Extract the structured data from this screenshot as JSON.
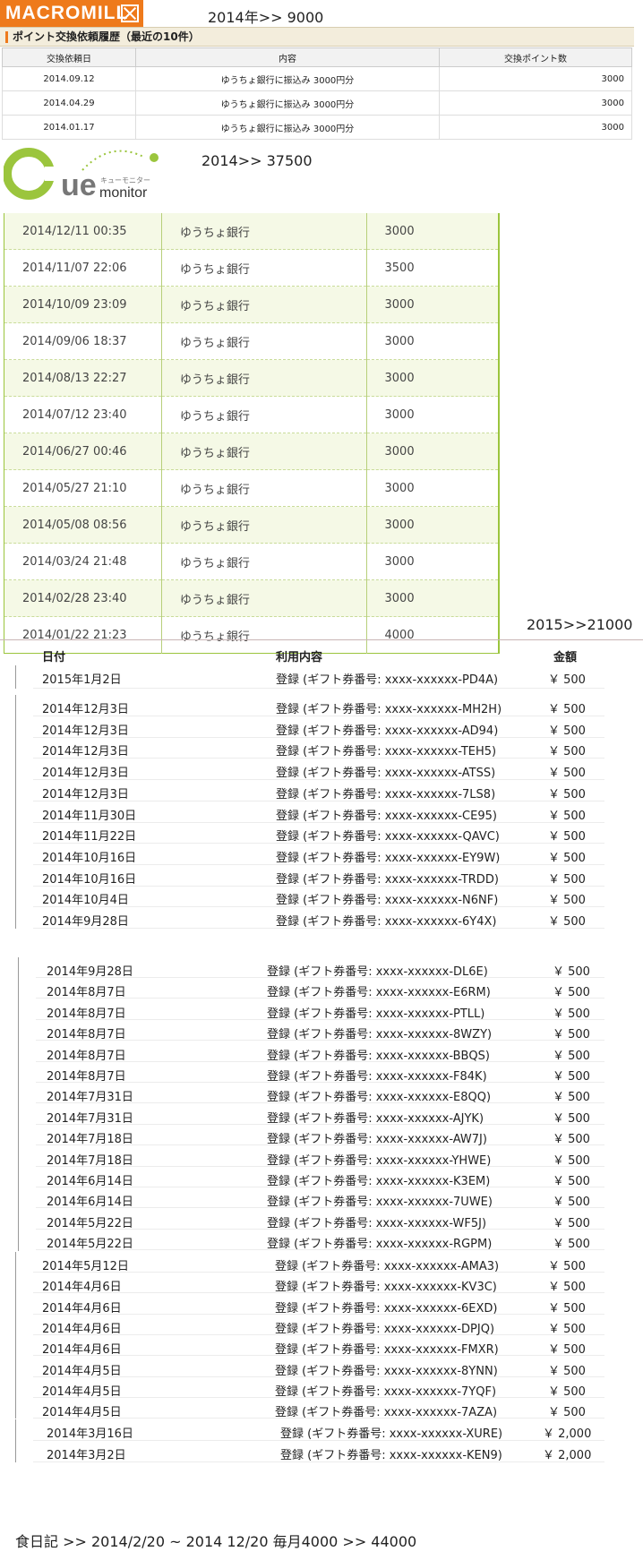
{
  "macromill": {
    "logo_text": "MACROMILL",
    "total": "2014年>> 9000",
    "header": "ポイント交換依頼履歴（最近の10件）",
    "columns": [
      "交換依頼日",
      "内容",
      "交換ポイント数"
    ],
    "rows": [
      {
        "date": "2014.09.12",
        "content": "ゆうちょ銀行に振込み 3000円分",
        "points": "3000"
      },
      {
        "date": "2014.04.29",
        "content": "ゆうちょ銀行に振込み 3000円分",
        "points": "3000"
      },
      {
        "date": "2014.01.17",
        "content": "ゆうちょ銀行に振込み 3000円分",
        "points": "3000"
      }
    ]
  },
  "cue": {
    "logo_main": "Cue",
    "logo_sub": "monitor",
    "logo_kana": "キューモニター",
    "total": "2014>> 37500",
    "rows": [
      {
        "date": "2014/12/11 00:35",
        "bank": "ゆうちょ銀行",
        "amount": "3000"
      },
      {
        "date": "2014/11/07 22:06",
        "bank": "ゆうちょ銀行",
        "amount": "3500"
      },
      {
        "date": "2014/10/09 23:09",
        "bank": "ゆうちょ銀行",
        "amount": "3000"
      },
      {
        "date": "2014/09/06 18:37",
        "bank": "ゆうちょ銀行",
        "amount": "3000"
      },
      {
        "date": "2014/08/13 22:27",
        "bank": "ゆうちょ銀行",
        "amount": "3000"
      },
      {
        "date": "2014/07/12 23:40",
        "bank": "ゆうちょ銀行",
        "amount": "3000"
      },
      {
        "date": "2014/06/27 00:46",
        "bank": "ゆうちょ銀行",
        "amount": "3000"
      },
      {
        "date": "2014/05/27 21:10",
        "bank": "ゆうちょ銀行",
        "amount": "3000"
      },
      {
        "date": "2014/05/08 08:56",
        "bank": "ゆうちょ銀行",
        "amount": "3000"
      },
      {
        "date": "2014/03/24 21:48",
        "bank": "ゆうちょ銀行",
        "amount": "3000"
      },
      {
        "date": "2014/02/28 23:40",
        "bank": "ゆうちょ銀行",
        "amount": "3000"
      },
      {
        "date": "2014/01/22 21:23",
        "bank": "ゆうちょ銀行",
        "amount": "4000"
      }
    ]
  },
  "gift": {
    "total": "2015>>21000",
    "columns": [
      "日付",
      "利用内容",
      "金額"
    ],
    "rows": [
      {
        "date": "2015年1月2日",
        "desc": "登録 (ギフト券番号: xxxx-xxxxxx-PD4A)",
        "amount": "￥ 500"
      },
      {
        "date": "2014年12月3日",
        "desc": "登録 (ギフト券番号: xxxx-xxxxxx-MH2H)",
        "amount": "￥ 500"
      },
      {
        "date": "2014年12月3日",
        "desc": "登録 (ギフト券番号: xxxx-xxxxxx-AD94)",
        "amount": "￥ 500"
      },
      {
        "date": "2014年12月3日",
        "desc": "登録 (ギフト券番号: xxxx-xxxxxx-TEH5)",
        "amount": "￥ 500"
      },
      {
        "date": "2014年12月3日",
        "desc": "登録 (ギフト券番号: xxxx-xxxxxx-ATSS)",
        "amount": "￥ 500"
      },
      {
        "date": "2014年12月3日",
        "desc": "登録 (ギフト券番号: xxxx-xxxxxx-7LS8)",
        "amount": "￥ 500"
      },
      {
        "date": "2014年11月30日",
        "desc": "登録 (ギフト券番号: xxxx-xxxxxx-CE95)",
        "amount": "￥ 500"
      },
      {
        "date": "2014年11月22日",
        "desc": "登録 (ギフト券番号: xxxx-xxxxxx-QAVC)",
        "amount": "￥ 500"
      },
      {
        "date": "2014年10月16日",
        "desc": "登録 (ギフト券番号: xxxx-xxxxxx-EY9W)",
        "amount": "￥ 500"
      },
      {
        "date": "2014年10月16日",
        "desc": "登録 (ギフト券番号: xxxx-xxxxxx-TRDD)",
        "amount": "￥ 500"
      },
      {
        "date": "2014年10月4日",
        "desc": "登録 (ギフト券番号: xxxx-xxxxxx-N6NF)",
        "amount": "￥ 500"
      },
      {
        "date": "2014年9月28日",
        "desc": "登録 (ギフト券番号: xxxx-xxxxxx-6Y4X)",
        "amount": "￥ 500"
      },
      {
        "date": "2014年9月28日",
        "desc": "登録 (ギフト券番号: xxxx-xxxxxx-DL6E)",
        "amount": "￥ 500"
      },
      {
        "date": "2014年8月7日",
        "desc": "登録 (ギフト券番号: xxxx-xxxxxx-E6RM)",
        "amount": "￥ 500"
      },
      {
        "date": "2014年8月7日",
        "desc": "登録 (ギフト券番号: xxxx-xxxxxx-PTLL)",
        "amount": "￥ 500"
      },
      {
        "date": "2014年8月7日",
        "desc": "登録 (ギフト券番号: xxxx-xxxxxx-8WZY)",
        "amount": "￥ 500"
      },
      {
        "date": "2014年8月7日",
        "desc": "登録 (ギフト券番号: xxxx-xxxxxx-BBQS)",
        "amount": "￥ 500"
      },
      {
        "date": "2014年8月7日",
        "desc": "登録 (ギフト券番号: xxxx-xxxxxx-F84K)",
        "amount": "￥ 500"
      },
      {
        "date": "2014年7月31日",
        "desc": "登録 (ギフト券番号: xxxx-xxxxxx-E8QQ)",
        "amount": "￥ 500"
      },
      {
        "date": "2014年7月31日",
        "desc": "登録 (ギフト券番号: xxxx-xxxxxx-AJYK)",
        "amount": "￥ 500"
      },
      {
        "date": "2014年7月18日",
        "desc": "登録 (ギフト券番号: xxxx-xxxxxx-AW7J)",
        "amount": "￥ 500"
      },
      {
        "date": "2014年7月18日",
        "desc": "登録 (ギフト券番号: xxxx-xxxxxx-YHWE)",
        "amount": "￥ 500"
      },
      {
        "date": "2014年6月14日",
        "desc": "登録 (ギフト券番号: xxxx-xxxxxx-K3EM)",
        "amount": "￥ 500"
      },
      {
        "date": "2014年6月14日",
        "desc": "登録 (ギフト券番号: xxxx-xxxxxx-7UWE)",
        "amount": "￥ 500"
      },
      {
        "date": "2014年5月22日",
        "desc": "登録 (ギフト券番号: xxxx-xxxxxx-WF5J)",
        "amount": "￥ 500"
      },
      {
        "date": "2014年5月22日",
        "desc": "登録 (ギフト券番号: xxxx-xxxxxx-RGPM)",
        "amount": "￥ 500"
      },
      {
        "date": "2014年5月12日",
        "desc": "登録 (ギフト券番号: xxxx-xxxxxx-AMA3)",
        "amount": "￥ 500"
      },
      {
        "date": "2014年4月6日",
        "desc": "登録 (ギフト券番号: xxxx-xxxxxx-KV3C)",
        "amount": "￥ 500"
      },
      {
        "date": "2014年4月6日",
        "desc": "登録 (ギフト券番号: xxxx-xxxxxx-6EXD)",
        "amount": "￥ 500"
      },
      {
        "date": "2014年4月6日",
        "desc": "登録 (ギフト券番号: xxxx-xxxxxx-DPJQ)",
        "amount": "￥ 500"
      },
      {
        "date": "2014年4月6日",
        "desc": "登録 (ギフト券番号: xxxx-xxxxxx-FMXR)",
        "amount": "￥ 500"
      },
      {
        "date": "2014年4月5日",
        "desc": "登録 (ギフト券番号: xxxx-xxxxxx-8YNN)",
        "amount": "￥ 500"
      },
      {
        "date": "2014年4月5日",
        "desc": "登録 (ギフト券番号: xxxx-xxxxxx-7YQF)",
        "amount": "￥ 500"
      },
      {
        "date": "2014年4月5日",
        "desc": "登録 (ギフト券番号: xxxx-xxxxxx-7AZA)",
        "amount": "￥ 500"
      },
      {
        "date": "2014年3月16日",
        "desc": "登録 (ギフト券番号: xxxx-xxxxxx-XURE)",
        "amount": "￥ 2,000"
      },
      {
        "date": "2014年3月2日",
        "desc": "登録 (ギフト券番号: xxxx-xxxxxx-KEN9)",
        "amount": "￥ 2,000"
      }
    ]
  },
  "diary": "食日記 >> 2014/2/20 ~ 2014 12/20 毎月4000 >> 44000",
  "colors": {
    "macromill_orange": "#ee7a1b",
    "cue_green": "#9bc53d",
    "cue_gray": "#777777"
  }
}
